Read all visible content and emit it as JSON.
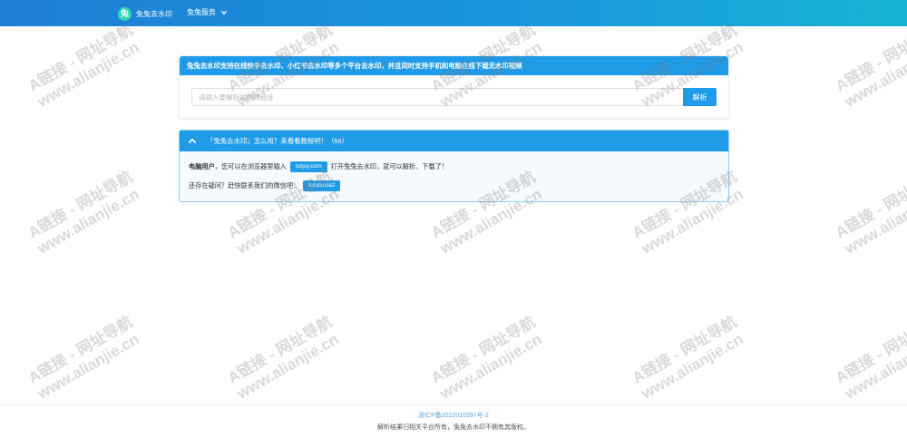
{
  "header": {
    "logo_glyph": "兔",
    "brand": "兔兔去水印",
    "menu_label": "兔兔服务"
  },
  "intro_card": {
    "title": "兔兔去水印支持在线快手去水印、小红书去水印等多个平台去水印，并且同时支持手机和电脑在线下载无水印视频",
    "input_placeholder": "请输入要解析的视频链接",
    "input_value": "",
    "button_label": "解析"
  },
  "help_card": {
    "title": "『兔兔去水印』怎么用？来看看教程吧！（66）",
    "line1_prefix": "电脑用户",
    "line1_text": "，您可以在浏览器里输入",
    "line1_tag": "tutjsy.com",
    "line1_suffix": "打开兔兔去水印，就可以解析、下载了！",
    "line2_text": "还存在疑问？赶快联系我们的微信吧：",
    "line2_tag": "tutuliuxia2"
  },
  "footer": {
    "icp": "浙ICP备2022010397号-2",
    "rights": "解析结果归相关平台所有，兔兔去水印不拥有其版权。"
  },
  "watermark": {
    "line1": "A链接 - 网址导航",
    "line2": "www.alianjie.cn"
  },
  "colors": {
    "accent": "#1f9be8",
    "header_start": "#1e7fd6",
    "header_end": "#17b4d2"
  }
}
